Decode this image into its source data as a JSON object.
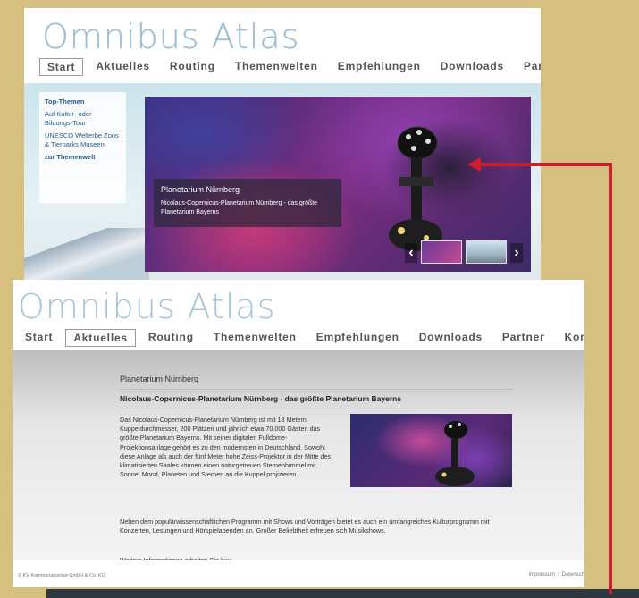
{
  "logo": "Omnibus Atlas",
  "screen1": {
    "nav": [
      "Start",
      "Aktuelles",
      "Routing",
      "Themenwelten",
      "Empfehlungen",
      "Downloads",
      "Partner"
    ],
    "sidebar": {
      "head": "Top-Themen",
      "items": [
        "Auf Kultur- oder Bildungs-Tour",
        "UNESCO Welterbe Zoos & Tierparks Museen"
      ],
      "link": "zur Themenwelt"
    },
    "hero": {
      "title": "Planetarium Nürnberg",
      "subtitle": "Nicolaus-Copernicus-Planetarium Nürnberg - das größte Planetarium Bayerns"
    }
  },
  "screen2": {
    "nav": [
      "Start",
      "Aktuelles",
      "Routing",
      "Themenwelten",
      "Empfehlungen",
      "Downloads",
      "Partner",
      "Kontakt"
    ],
    "article": {
      "title": "Planetarium Nürnberg",
      "subtitle": "Nicolaus-Copernicus-Planetarium Nürnberg - das größte Planetarium Bayerns",
      "p1": "Das Nicolaus-Copernicus-Planetarium Nürnberg ist mit 18 Metern Kuppeldurchmesser, 200 Plätzen und jährlich etwa 70.000 Gästen das größte Planetarium Bayerns. Mit seiner digitalen Fulldome-Projektionsanlage gehört es zu den modernsten in Deutschland. Sowohl diese Anlage als auch der fünf Meter hohe Zeiss-Projektor in der Mitte des klimatisierten Saales können einen naturgetreuen Sternenhimmel mit Sonne, Mond, Planeten und Sternen an die Kuppel projizieren.",
      "p2": "Neben dem populärwissenschaftlichen Programm mit Shows und Vorträgen bietet es auch ein umfangreiches Kulturprogramm mit Konzerten, Lesungen und Hörspielabenden an. Großer Beliebtheit erfreuen sich Musikshows.",
      "p3_prefix": "Weitere Informationen erhalten Sie",
      "p3_link": "hier"
    },
    "footer": {
      "copyright": "© KV Kommunalverlag GmbH & Co. KG",
      "links": [
        "Impressum",
        "Datensch"
      ]
    }
  },
  "colors": {
    "arrow": "#c8202a",
    "background": "#d6c080",
    "logo": "#a4c6d8"
  }
}
